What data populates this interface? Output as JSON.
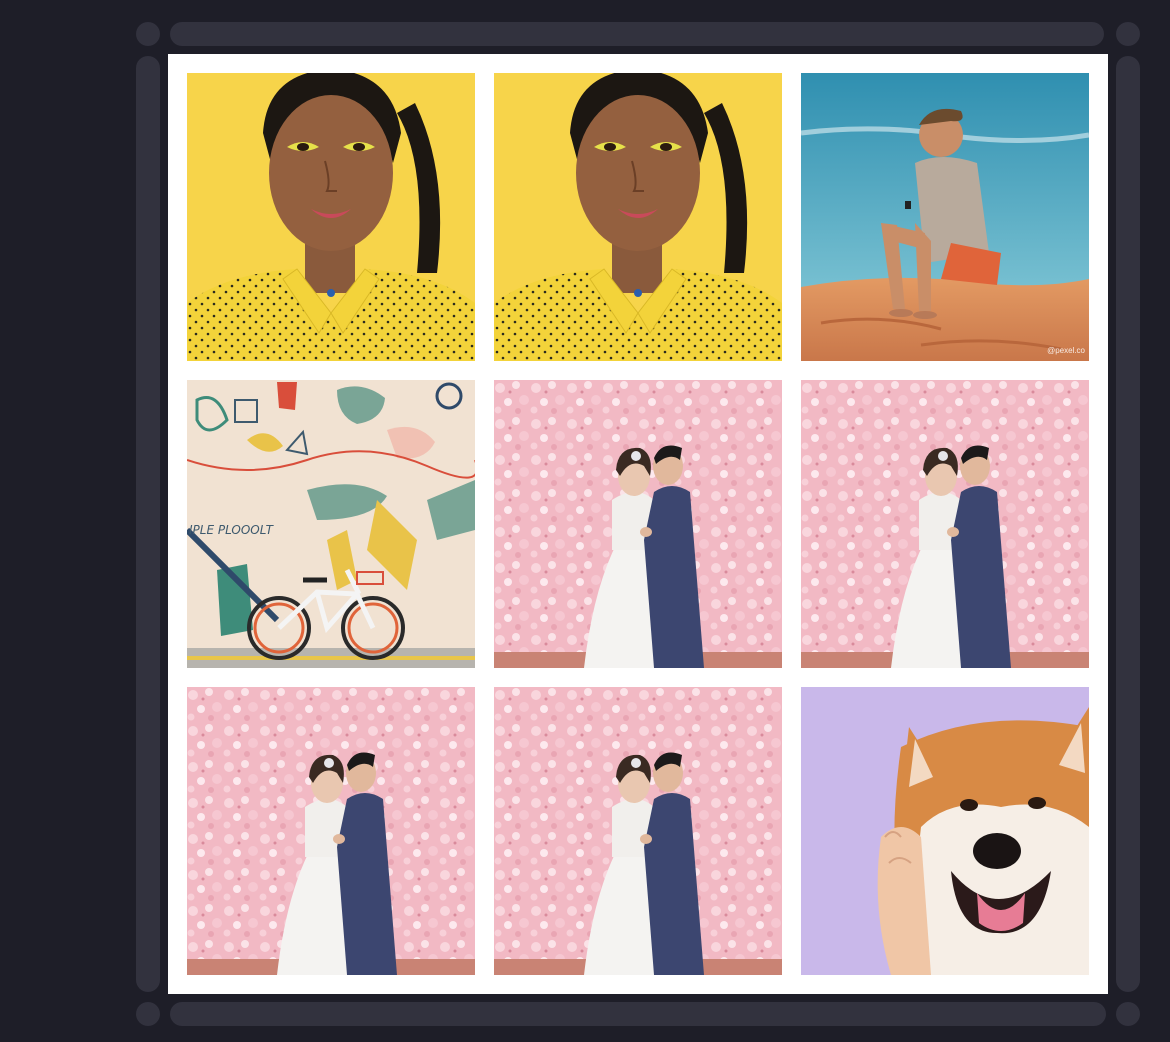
{
  "canvas": {
    "background": "#ffffff",
    "tiles": [
      {
        "name": "woman-yellow-portrait",
        "kind": "woman_yellow"
      },
      {
        "name": "woman-yellow-portrait",
        "kind": "woman_yellow"
      },
      {
        "name": "man-desert-sitting",
        "kind": "man_desert",
        "watermark": "@pexel.co"
      },
      {
        "name": "mural-bicycle",
        "kind": "mural_bike",
        "mural_text": "IPLE PLOOOLT"
      },
      {
        "name": "wedding-couple-pink",
        "kind": "wedding"
      },
      {
        "name": "wedding-couple-pink",
        "kind": "wedding"
      },
      {
        "name": "wedding-couple-pink",
        "kind": "wedding"
      },
      {
        "name": "wedding-couple-pink",
        "kind": "wedding"
      },
      {
        "name": "shiba-dog-purple",
        "kind": "shiba"
      }
    ]
  },
  "colors": {
    "app_background": "#1e1e28",
    "rail": "#32323e",
    "yellow_bg": "#f7d44a",
    "sky": "#3f9fb8",
    "sand": "#d98a55",
    "mural_bg": "#f1e2d2",
    "blossom": "#f2b9c4",
    "lavender": "#c9b8ea"
  }
}
